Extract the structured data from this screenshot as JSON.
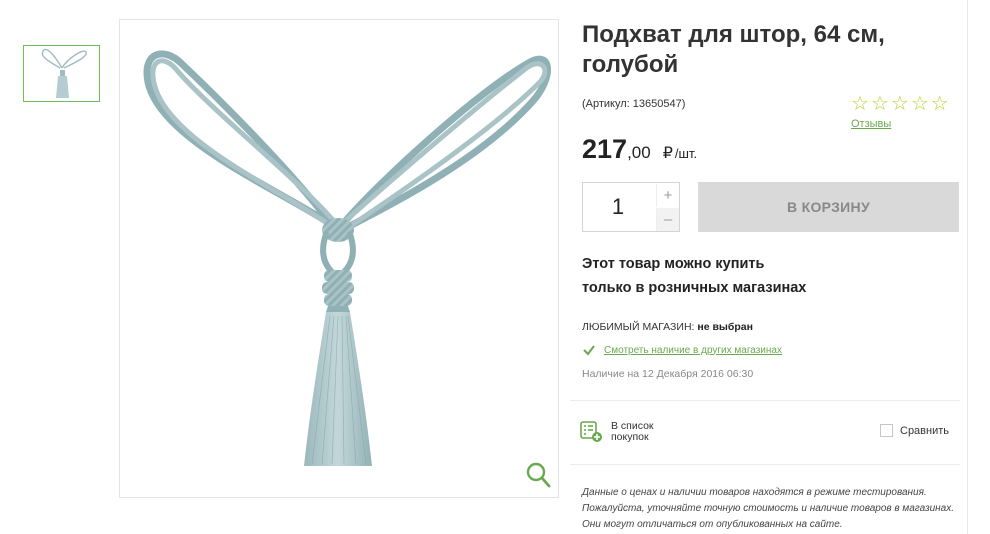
{
  "product": {
    "title": "Подхват для штор, 64 см, голубой",
    "sku": "(Артикул: 13650547)",
    "reviews_label": "Отзывы",
    "rating_stars": 5,
    "rating_value": 0,
    "price_int": "217",
    "price_dec": ",00",
    "currency": "₽",
    "unit": "/шт.",
    "quantity": "1",
    "plus_label": "+",
    "minus_label": "–",
    "cart_button_label": "В КОРЗИНУ",
    "retail_note_line1": "Этот товар можно купить",
    "retail_note_line2": "только в розничных магазинах"
  },
  "store": {
    "label": "ЛЮБИМЫЙ МАГАЗИН:",
    "value": "не выбран",
    "check_link": "Смотреть наличие в других магазинах",
    "availability": "Наличие на 12 Декабря 2016 06:30"
  },
  "actions": {
    "list_add_line1": "В список",
    "list_add_line2": "покупок",
    "compare_label": "Сравнить"
  },
  "disclaimer": {
    "line1": "Данные о ценах и наличии товаров находятся в режиме тестирования.",
    "line2": "Пожалуйста, уточняйте точную стоимость и наличие товаров в магазинах.",
    "line3": "Они могут отличаться от опубликованных на сайте."
  },
  "icons": {
    "star": "star-outline-icon",
    "zoom": "magnifier-icon",
    "check": "checkmark-icon",
    "list": "shopping-list-add-icon"
  },
  "colors": {
    "accent_green": "#6aa84f",
    "star_yellow": "#b8d433",
    "cart_disabled_bg": "#d9d9d9",
    "cord_blue": "#9fbcc0"
  }
}
